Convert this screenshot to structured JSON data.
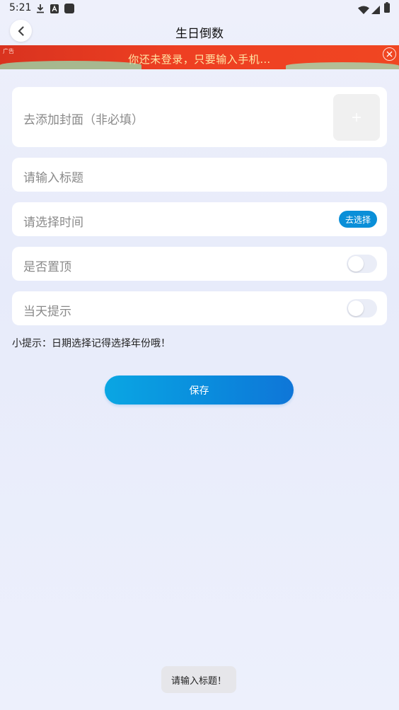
{
  "status_bar": {
    "time": "5:21",
    "icons": [
      "download-icon",
      "a-icon",
      "square-icon",
      "wifi-icon",
      "signal-icon",
      "battery-icon"
    ]
  },
  "header": {
    "title": "生日倒数"
  },
  "ad": {
    "tag": "广告",
    "text": "你还未登录，只要输入手机…"
  },
  "form": {
    "cover_label": "去添加封面（非必填）",
    "title_placeholder": "请输入标题",
    "time_label": "请选择时间",
    "select_button": "去选择",
    "pin_label": "是否置顶",
    "pin_on": false,
    "remind_label": "当天提示",
    "remind_on": false
  },
  "tip": "小提示：日期选择记得选择年份哦！",
  "save_button": "保存",
  "toast": "请输入标题！",
  "colors": {
    "accent": "#0a8fd8",
    "ad_bg": "#ee3f22",
    "ad_text": "#ffe6a6"
  }
}
